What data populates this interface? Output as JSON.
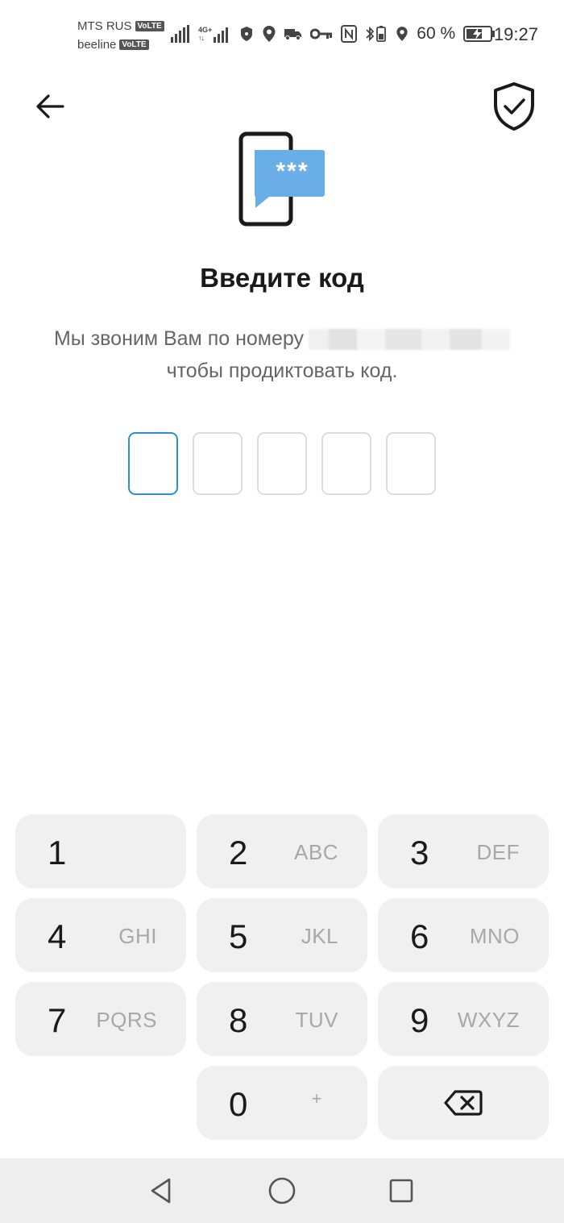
{
  "status_bar": {
    "carrier1": "MTS RUS",
    "carrier2": "beeline",
    "volte": "VoLTE",
    "network": "4G+",
    "battery": "60 %",
    "time": "19:27"
  },
  "header": {
    "back_icon": "arrow-left-icon",
    "shield_icon": "shield-check-icon"
  },
  "illustration": {
    "icon": "phone-sms-code-icon",
    "bubble_text": "***",
    "accent_color": "#6aaee8"
  },
  "title": "Введите код",
  "description": {
    "line1": "Мы звоним Вам по номеру",
    "line2": "чтобы продиктовать код."
  },
  "code": {
    "length": 5,
    "active_index": 0,
    "active_color": "#2e8ed4"
  },
  "keypad": [
    {
      "digit": "1",
      "letters": ""
    },
    {
      "digit": "2",
      "letters": "ABC"
    },
    {
      "digit": "3",
      "letters": "DEF"
    },
    {
      "digit": "4",
      "letters": "GHI"
    },
    {
      "digit": "5",
      "letters": "JKL"
    },
    {
      "digit": "6",
      "letters": "MNO"
    },
    {
      "digit": "7",
      "letters": "PQRS"
    },
    {
      "digit": "8",
      "letters": "TUV"
    },
    {
      "digit": "9",
      "letters": "WXYZ"
    },
    {
      "digit": "0",
      "letters": "+"
    }
  ],
  "navbar": {
    "back": "triangle-back-icon",
    "home": "circle-home-icon",
    "recents": "square-recents-icon"
  }
}
